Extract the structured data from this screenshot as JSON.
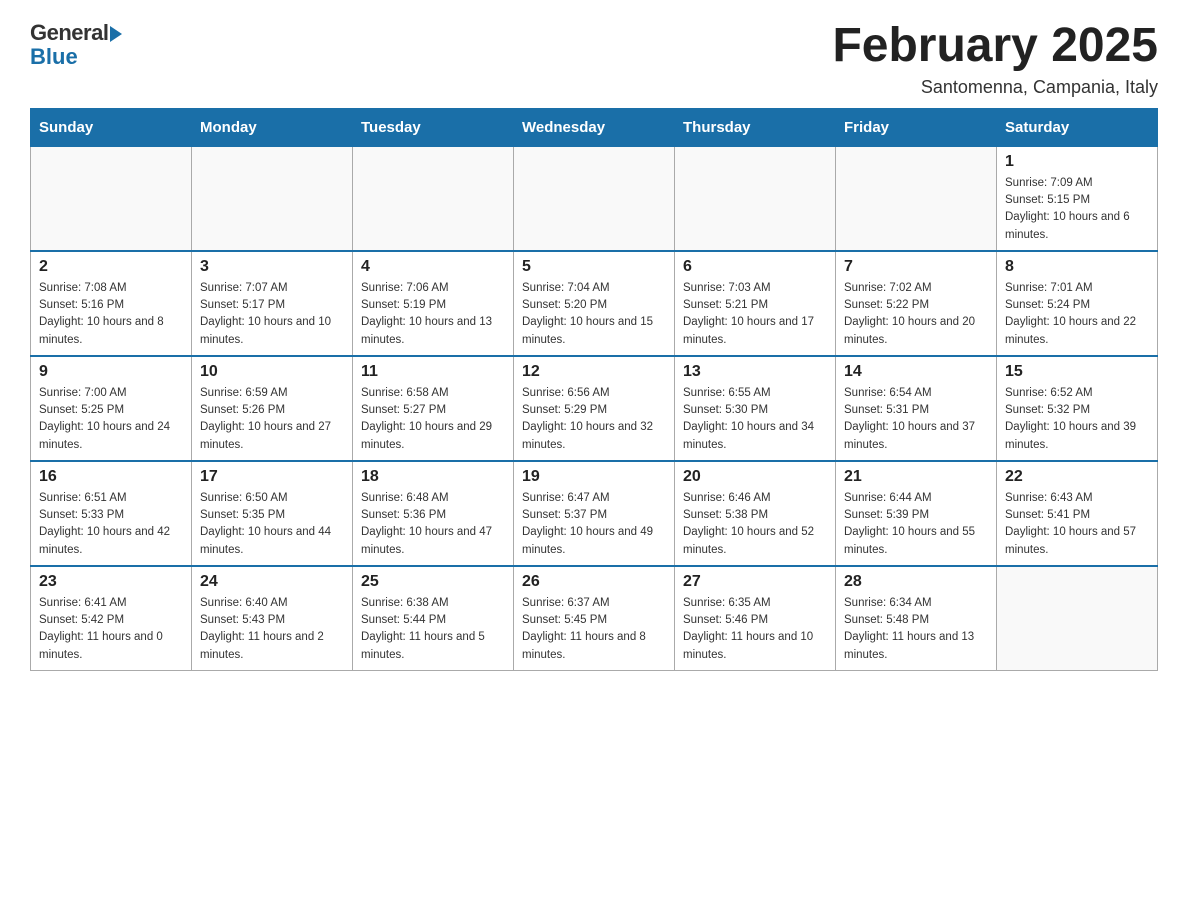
{
  "logo": {
    "general": "General",
    "blue": "Blue"
  },
  "title": "February 2025",
  "location": "Santomenna, Campania, Italy",
  "weekdays": [
    "Sunday",
    "Monday",
    "Tuesday",
    "Wednesday",
    "Thursday",
    "Friday",
    "Saturday"
  ],
  "weeks": [
    [
      {
        "day": "",
        "info": ""
      },
      {
        "day": "",
        "info": ""
      },
      {
        "day": "",
        "info": ""
      },
      {
        "day": "",
        "info": ""
      },
      {
        "day": "",
        "info": ""
      },
      {
        "day": "",
        "info": ""
      },
      {
        "day": "1",
        "info": "Sunrise: 7:09 AM\nSunset: 5:15 PM\nDaylight: 10 hours and 6 minutes."
      }
    ],
    [
      {
        "day": "2",
        "info": "Sunrise: 7:08 AM\nSunset: 5:16 PM\nDaylight: 10 hours and 8 minutes."
      },
      {
        "day": "3",
        "info": "Sunrise: 7:07 AM\nSunset: 5:17 PM\nDaylight: 10 hours and 10 minutes."
      },
      {
        "day": "4",
        "info": "Sunrise: 7:06 AM\nSunset: 5:19 PM\nDaylight: 10 hours and 13 minutes."
      },
      {
        "day": "5",
        "info": "Sunrise: 7:04 AM\nSunset: 5:20 PM\nDaylight: 10 hours and 15 minutes."
      },
      {
        "day": "6",
        "info": "Sunrise: 7:03 AM\nSunset: 5:21 PM\nDaylight: 10 hours and 17 minutes."
      },
      {
        "day": "7",
        "info": "Sunrise: 7:02 AM\nSunset: 5:22 PM\nDaylight: 10 hours and 20 minutes."
      },
      {
        "day": "8",
        "info": "Sunrise: 7:01 AM\nSunset: 5:24 PM\nDaylight: 10 hours and 22 minutes."
      }
    ],
    [
      {
        "day": "9",
        "info": "Sunrise: 7:00 AM\nSunset: 5:25 PM\nDaylight: 10 hours and 24 minutes."
      },
      {
        "day": "10",
        "info": "Sunrise: 6:59 AM\nSunset: 5:26 PM\nDaylight: 10 hours and 27 minutes."
      },
      {
        "day": "11",
        "info": "Sunrise: 6:58 AM\nSunset: 5:27 PM\nDaylight: 10 hours and 29 minutes."
      },
      {
        "day": "12",
        "info": "Sunrise: 6:56 AM\nSunset: 5:29 PM\nDaylight: 10 hours and 32 minutes."
      },
      {
        "day": "13",
        "info": "Sunrise: 6:55 AM\nSunset: 5:30 PM\nDaylight: 10 hours and 34 minutes."
      },
      {
        "day": "14",
        "info": "Sunrise: 6:54 AM\nSunset: 5:31 PM\nDaylight: 10 hours and 37 minutes."
      },
      {
        "day": "15",
        "info": "Sunrise: 6:52 AM\nSunset: 5:32 PM\nDaylight: 10 hours and 39 minutes."
      }
    ],
    [
      {
        "day": "16",
        "info": "Sunrise: 6:51 AM\nSunset: 5:33 PM\nDaylight: 10 hours and 42 minutes."
      },
      {
        "day": "17",
        "info": "Sunrise: 6:50 AM\nSunset: 5:35 PM\nDaylight: 10 hours and 44 minutes."
      },
      {
        "day": "18",
        "info": "Sunrise: 6:48 AM\nSunset: 5:36 PM\nDaylight: 10 hours and 47 minutes."
      },
      {
        "day": "19",
        "info": "Sunrise: 6:47 AM\nSunset: 5:37 PM\nDaylight: 10 hours and 49 minutes."
      },
      {
        "day": "20",
        "info": "Sunrise: 6:46 AM\nSunset: 5:38 PM\nDaylight: 10 hours and 52 minutes."
      },
      {
        "day": "21",
        "info": "Sunrise: 6:44 AM\nSunset: 5:39 PM\nDaylight: 10 hours and 55 minutes."
      },
      {
        "day": "22",
        "info": "Sunrise: 6:43 AM\nSunset: 5:41 PM\nDaylight: 10 hours and 57 minutes."
      }
    ],
    [
      {
        "day": "23",
        "info": "Sunrise: 6:41 AM\nSunset: 5:42 PM\nDaylight: 11 hours and 0 minutes."
      },
      {
        "day": "24",
        "info": "Sunrise: 6:40 AM\nSunset: 5:43 PM\nDaylight: 11 hours and 2 minutes."
      },
      {
        "day": "25",
        "info": "Sunrise: 6:38 AM\nSunset: 5:44 PM\nDaylight: 11 hours and 5 minutes."
      },
      {
        "day": "26",
        "info": "Sunrise: 6:37 AM\nSunset: 5:45 PM\nDaylight: 11 hours and 8 minutes."
      },
      {
        "day": "27",
        "info": "Sunrise: 6:35 AM\nSunset: 5:46 PM\nDaylight: 11 hours and 10 minutes."
      },
      {
        "day": "28",
        "info": "Sunrise: 6:34 AM\nSunset: 5:48 PM\nDaylight: 11 hours and 13 minutes."
      },
      {
        "day": "",
        "info": ""
      }
    ]
  ]
}
